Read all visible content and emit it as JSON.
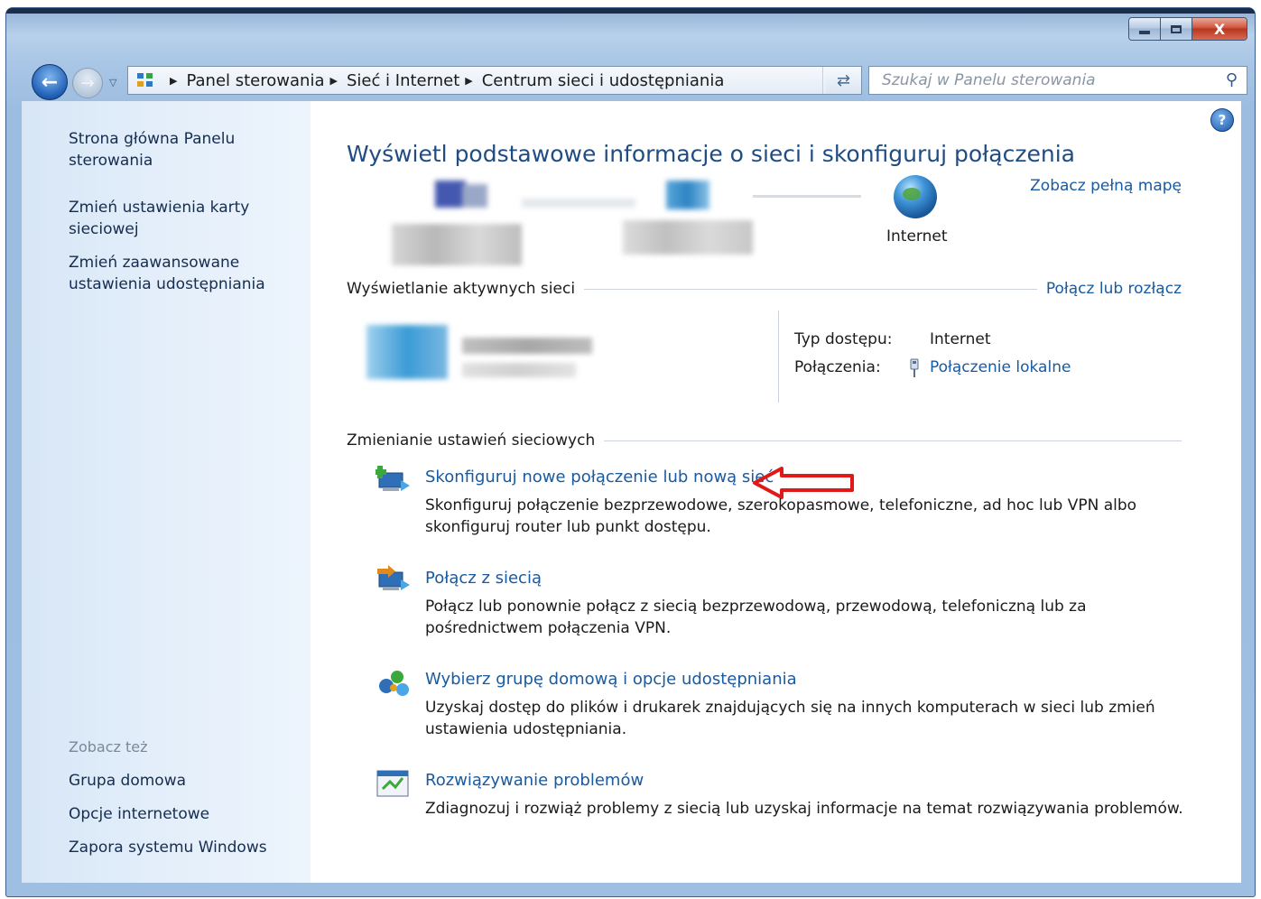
{
  "window": {
    "buttons": {
      "minimize": "minimize",
      "maximize": "maximize",
      "close": "X"
    }
  },
  "address_bar": {
    "crumbs": [
      "Panel sterowania",
      "Sieć i Internet",
      "Centrum sieci i udostępniania"
    ]
  },
  "search": {
    "placeholder": "Szukaj w Panelu sterowania"
  },
  "sidebar": {
    "home_link": "Strona główna Panelu sterowania",
    "links": [
      "Zmień ustawienia karty sieciowej",
      "Zmień zaawansowane ustawienia udostępniania"
    ],
    "see_also_title": "Zobacz też",
    "see_also": [
      "Grupa domowa",
      "Opcje internetowe",
      "Zapora systemu Windows"
    ]
  },
  "main": {
    "title": "Wyświetl podstawowe informacje o sieci i skonfiguruj połączenia",
    "see_full_map": "Zobacz pełną mapę",
    "internet_label": "Internet",
    "active_networks": {
      "heading": "Wyświetlanie aktywnych sieci",
      "action": "Połącz lub rozłącz",
      "access_type_label": "Typ dostępu:",
      "access_type_value": "Internet",
      "connections_label": "Połączenia:",
      "connections_value": "Połączenie lokalne"
    },
    "change_settings": {
      "heading": "Zmienianie ustawień sieciowych",
      "tasks": [
        {
          "link": "Skonfiguruj nowe połączenie lub nową sieć",
          "line1": "Skonfiguruj połączenie bezprzewodowe, szerokopasmowe, telefoniczne, ad hoc lub VPN albo",
          "line2": "skonfiguruj router lub punkt dostępu."
        },
        {
          "link": "Połącz z siecią",
          "line1": "Połącz lub ponownie połącz z siecią bezprzewodową, przewodową, telefoniczną lub za",
          "line2": "pośrednictwem połączenia VPN."
        },
        {
          "link": "Wybierz grupę domową i opcje udostępniania",
          "line1": "Uzyskaj dostęp do plików i drukarek znajdujących się na innych komputerach w sieci lub zmień",
          "line2": "ustawienia udostępniania."
        },
        {
          "link": "Rozwiązywanie problemów",
          "line1": "Zdiagnozuj i rozwiąż problemy z siecią lub uzyskaj informacje na temat rozwiązywania problemów.",
          "line2": ""
        }
      ]
    }
  },
  "colors": {
    "link": "#1a5aa0",
    "title": "#1f4c82",
    "annotation_arrow": "#e01818"
  }
}
